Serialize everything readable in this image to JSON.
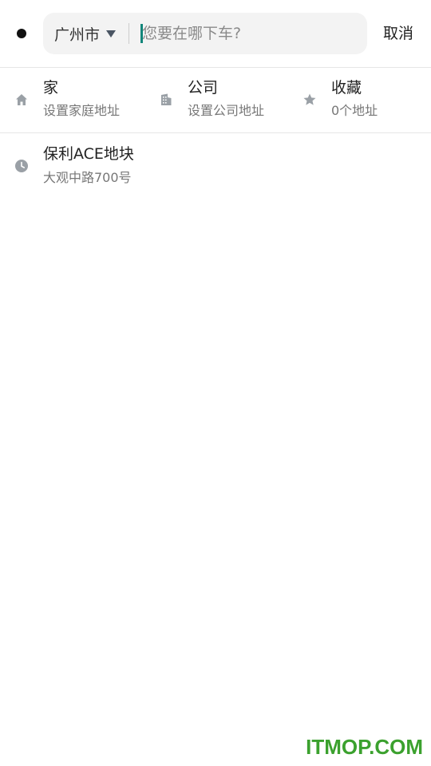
{
  "search": {
    "city": "广州市",
    "placeholder": "您要在哪下车?",
    "value": "",
    "cancel_label": "取消"
  },
  "shortcuts": [
    {
      "icon": "home-icon",
      "title": "家",
      "subtitle": "设置家庭地址"
    },
    {
      "icon": "building-icon",
      "title": "公司",
      "subtitle": "设置公司地址"
    },
    {
      "icon": "star-icon",
      "title": "收藏",
      "subtitle": "0个地址"
    }
  ],
  "history": [
    {
      "icon": "clock-icon",
      "title": "保利ACE地块",
      "subtitle": "大观中路700号"
    }
  ],
  "watermark": "ITMOP.COM",
  "colors": {
    "accent": "#12867a",
    "icon_gray": "#9aa0a6",
    "watermark": "#3ba12e"
  }
}
